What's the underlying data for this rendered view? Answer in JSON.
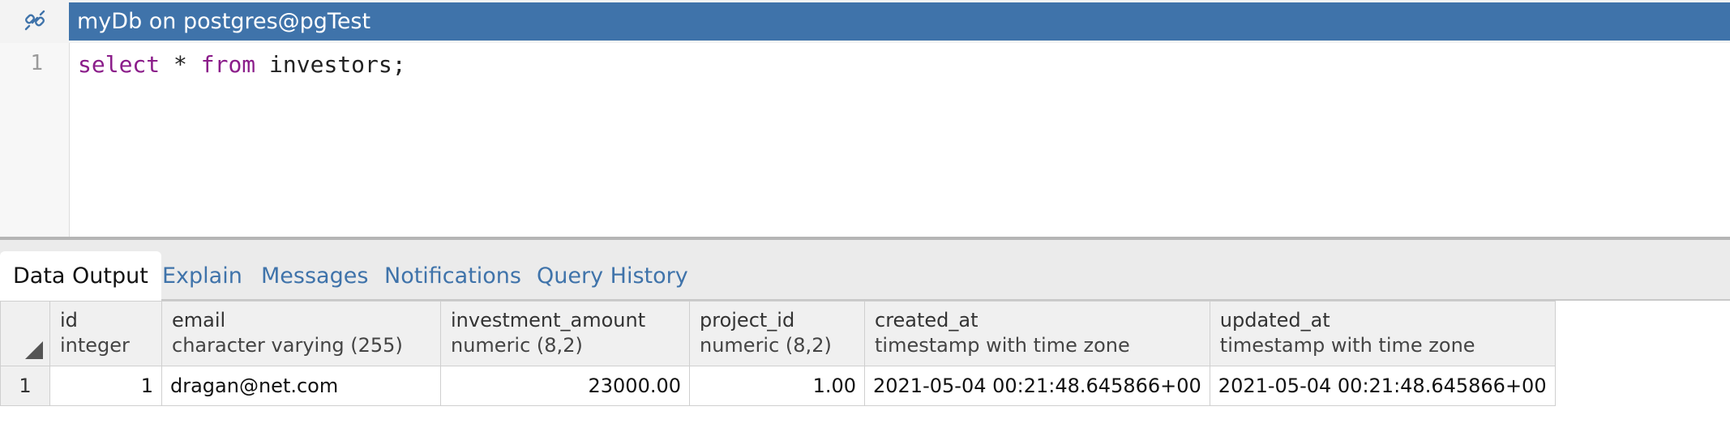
{
  "connection": {
    "title": "myDb on postgres@pgTest",
    "icon": "connection-icon",
    "bar_color": "#3f73aa"
  },
  "editor": {
    "line_number": "1",
    "query": {
      "kw1": "select",
      "mid": " * ",
      "kw2": "from",
      "rest": " investors;"
    }
  },
  "tabs": [
    {
      "label": "Data Output",
      "active": true
    },
    {
      "label": "Explain"
    },
    {
      "label": "Messages"
    },
    {
      "label": "Notifications"
    },
    {
      "label": "Query History"
    }
  ],
  "grid": {
    "columns": [
      {
        "name": "id",
        "type": "integer"
      },
      {
        "name": "email",
        "type": "character varying (255)"
      },
      {
        "name": "investment_amount",
        "type": "numeric (8,2)"
      },
      {
        "name": "project_id",
        "type": "numeric (8,2)"
      },
      {
        "name": "created_at",
        "type": "timestamp with time zone"
      },
      {
        "name": "updated_at",
        "type": "timestamp with time zone"
      }
    ],
    "rows": [
      {
        "row_number": "1",
        "cells": [
          "1",
          "dragan@net.com",
          "23000.00",
          "1.00",
          "2021-05-04 00:21:48.645866+00",
          "2021-05-04 00:21:48.645866+00"
        ]
      }
    ]
  }
}
